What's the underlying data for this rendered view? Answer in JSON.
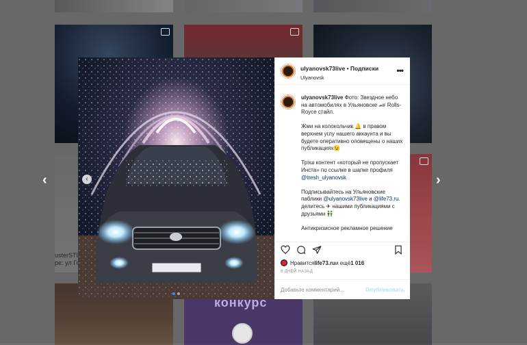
{
  "background_tiles": {
    "caption_line1": "usterSTUD",
    "caption_line2": "pe: ул Го",
    "contest_text": "конкурс"
  },
  "navigation": {
    "prev_arrow": "‹",
    "next_arrow": "›"
  },
  "post": {
    "username": "ulyanovsk73live",
    "follow_separator": " • ",
    "follow_label": "Подписки",
    "location": "Ulyanovsk",
    "more_icon": "•••",
    "caption_username": "ulyanovsk73live",
    "caption_p1": " Фото: Звездное небо на автомобилях в Ульяновске 🏎 Rolls-Royce стайл.",
    "caption_p2": "Жми на колокольчик 🔔 в правом верхнем углу нашего аккаунта и вы будете оперативно оповещены о наших публикациях😉",
    "caption_p3a": "Трэш контент «который не пропускает Инста» по ссылке в шапке профиля ",
    "caption_p3_link": "@tresh_ulyanovsk",
    "caption_p4a": "Подписывайтесь на Ульяновские паблики ",
    "caption_p4_link1": "@ulyanovsk73live",
    "caption_p4_and": " и ",
    "caption_p4_link2": "@life73.ru",
    "caption_p4b": ". делитесь ✈ нашими публикациями с друзьями 👬",
    "caption_p5": "Антикризисное рекламное решение",
    "likes_prefix": "Нравится ",
    "likes_user": "life73.ru",
    "likes_middle": " и ещё ",
    "likes_count": "1 016",
    "date": "6 ДНЕЙ НАЗАД",
    "comment_placeholder": "Добавьте комментарий...",
    "publish_label": "Опубликовать"
  },
  "carousel": {
    "slide_prev": "‹",
    "current_index": 1,
    "total": 2
  }
}
